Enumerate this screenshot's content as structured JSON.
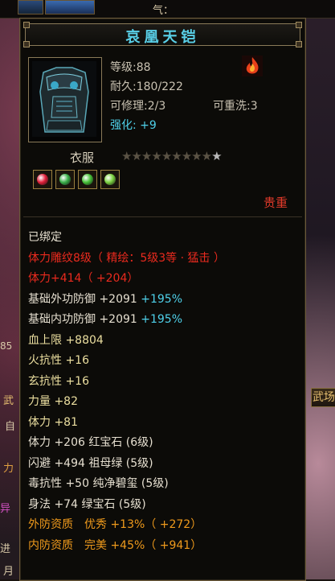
{
  "hud": {
    "qi_label": "气："
  },
  "side": {
    "left_fragments": [
      "85",
      "武",
      "自",
      "力",
      "异",
      "进",
      "月"
    ],
    "right_button": "武场"
  },
  "item": {
    "name": "哀凰天铠",
    "level": "等级:88",
    "durability": "耐久:180/222",
    "repairable": "可修理:2/3",
    "rewashable": "可重洗:3",
    "enhance_label": "强化:",
    "enhance_value": "+9",
    "type": "衣服",
    "stars_total": 10,
    "stars_lit": 1,
    "gem_colors": [
      "#e0203a",
      "#3ab04a",
      "#46c038",
      "#7ad040"
    ],
    "rarity": "贵重",
    "accent_color": "#4fd1ea",
    "attributes": [
      {
        "text": "已绑定",
        "color": "white"
      },
      {
        "text": "体力雕纹8级（ 精绘：5级3等 · 猛击 ）",
        "color": "red"
      },
      {
        "text": "体力+414（ +204）",
        "color": "red"
      },
      {
        "text": "基础外功防御 +2091",
        "extra": " +195%",
        "color": "white"
      },
      {
        "text": "基础内功防御 +2091",
        "extra": " +195%",
        "color": "white"
      },
      {
        "text": "血上限 +8804",
        "color": "yellow"
      },
      {
        "text": "火抗性 +16",
        "color": "yellow"
      },
      {
        "text": "玄抗性 +16",
        "color": "yellow"
      },
      {
        "text": "力量 +82",
        "color": "yellow"
      },
      {
        "text": "体力 +81",
        "color": "yellow"
      },
      {
        "text": "体力 +206 红宝石 (6级)",
        "color": "white"
      },
      {
        "text": "闪避 +494 祖母绿 (5级)",
        "color": "white"
      },
      {
        "text": "毒抗性 +50 纯净碧玺 (5级)",
        "color": "white"
      },
      {
        "text": "身法 +74 绿宝石 (5级)",
        "color": "white"
      },
      {
        "text": "外防资质　优秀 +13%（ +272）",
        "color": "orange"
      },
      {
        "text": "内防资质　完美 +45%（ +941）",
        "color": "orange"
      }
    ]
  }
}
